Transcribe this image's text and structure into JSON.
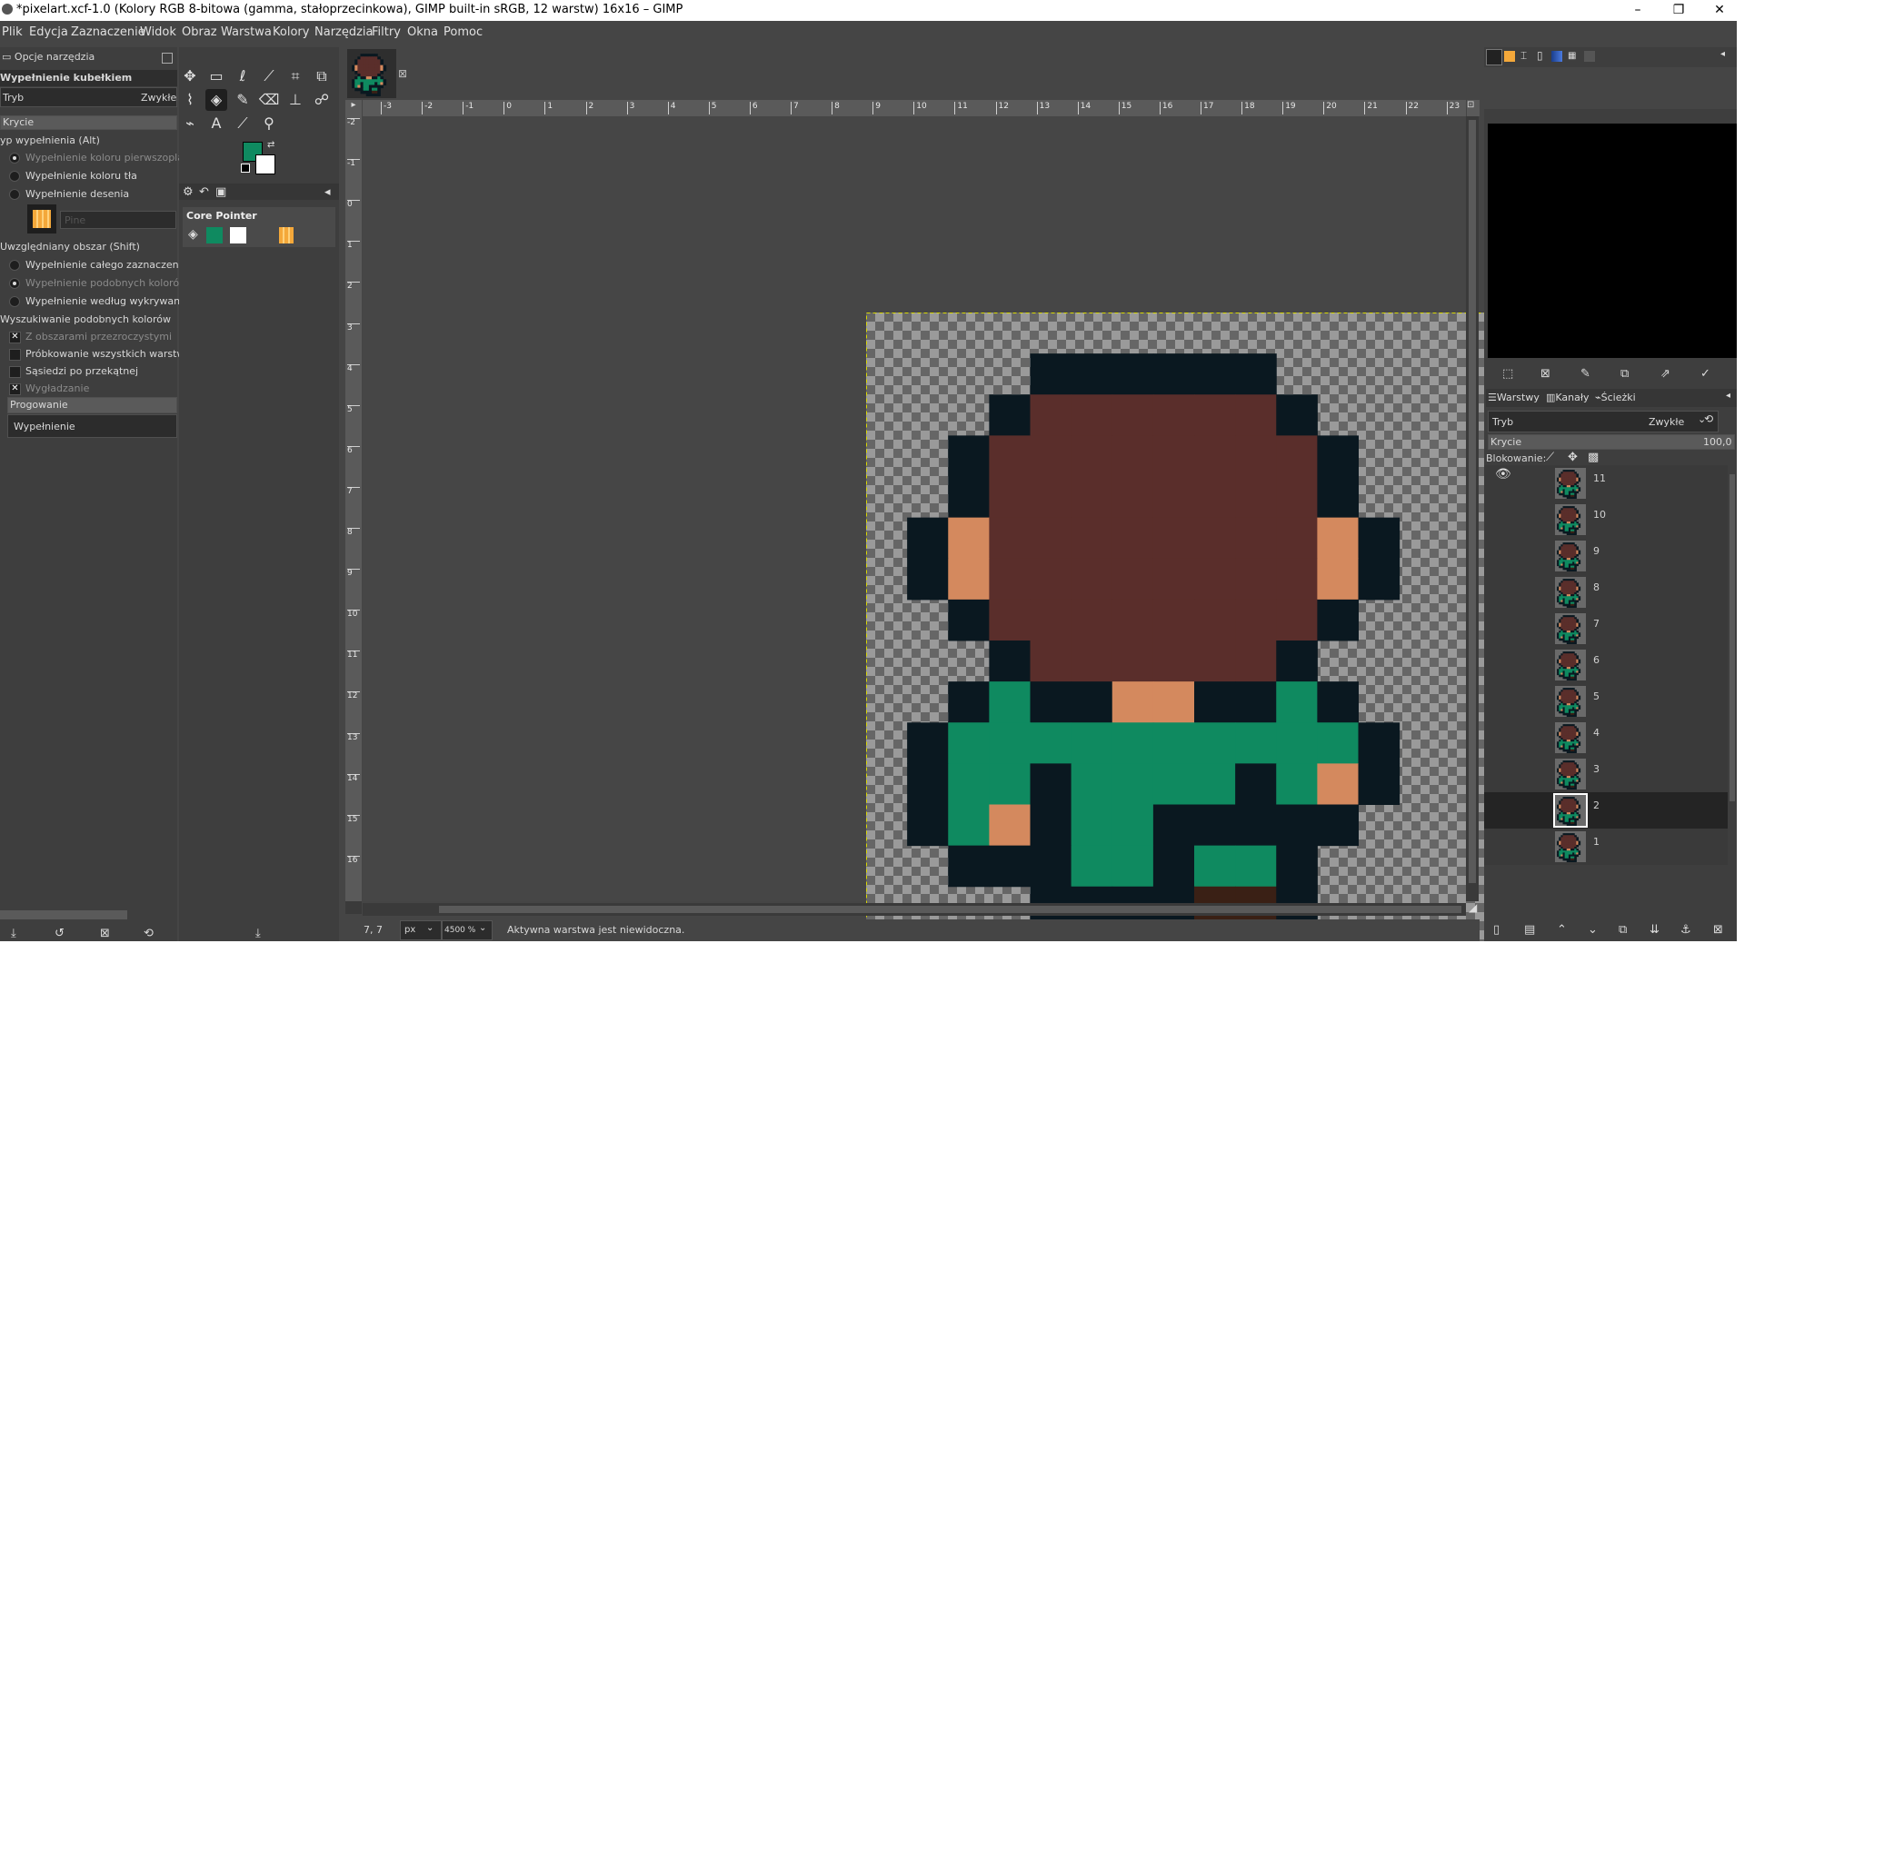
{
  "window": {
    "title": "*pixelart.xcf-1.0 (Kolory RGB 8-bitowa (gamma, stałoprzecinkowa), GIMP built-in sRGB, 12 warstw) 16x16 – GIMP",
    "minimize": "–",
    "restore": "❐",
    "close": "✕"
  },
  "menu": [
    "Plik",
    "Edycja",
    "Zaznaczenie",
    "Widok",
    "Obraz",
    "Warstwa",
    "Kolory",
    "Narzędzia",
    "Filtry",
    "Okna",
    "Pomoc"
  ],
  "tool_options": {
    "tab_title": "Opcje narzędzia",
    "tool_name": "Wypełnienie kubełkiem",
    "mode_label": "Tryb",
    "mode_value": "Zwykłe",
    "opacity_label": "Krycie",
    "fill_type_label": "yp wypełnienia  (Alt)",
    "fill_types": [
      {
        "label": "Wypełnienie koloru pierwszoplano",
        "selected": true
      },
      {
        "label": "Wypełnienie koloru tła",
        "selected": false
      },
      {
        "label": "Wypełnienie desenia",
        "selected": false
      }
    ],
    "pattern_name": "Pine",
    "area_label": "Uwzględniany obszar  (Shift)",
    "area_options": [
      {
        "label": "Wypełnienie całego zaznaczenia",
        "selected": false
      },
      {
        "label": "Wypełnienie podobnych kolorów",
        "selected": true
      },
      {
        "label": "Wypełnienie według wykrywania l",
        "selected": false
      }
    ],
    "similar_label": "Wyszukiwanie podobnych kolorów",
    "similar_options": [
      {
        "label": "Z obszarami przezroczystymi",
        "checked": true
      },
      {
        "label": "Próbkowanie wszystkich warstw",
        "checked": false
      },
      {
        "label": "Sąsiedzi po przekątnej",
        "checked": false
      },
      {
        "label": "Wygładzanie",
        "checked": true
      }
    ],
    "threshold_label": "Progowanie",
    "fill_by_label": "Wypełnienie"
  },
  "toolbox": {
    "device_status_title": "Core Pointer",
    "fg_color": "#0f8a60",
    "bg_color": "#ffffff"
  },
  "canvas": {
    "zoom": "4500 %",
    "unit": "px",
    "coords": "7, 7",
    "status_message": "Aktywna warstwa jest niewidoczna.",
    "ruler_h": [
      "-3",
      "-2",
      "-1",
      "0",
      "1",
      "2",
      "3",
      "4",
      "5",
      "6",
      "7",
      "8",
      "9",
      "10",
      "11",
      "12",
      "13",
      "14",
      "15",
      "16",
      "17",
      "18",
      "19",
      "20",
      "21",
      "22",
      "23"
    ],
    "ruler_v": [
      "-2",
      "-1",
      "0",
      "1",
      "2",
      "3",
      "4",
      "5",
      "6",
      "7",
      "8",
      "9",
      "10",
      "11",
      "12",
      "13",
      "14",
      "15",
      "16"
    ]
  },
  "layers_panel": {
    "tabs": [
      "Warstwy",
      "Kanały",
      "Ścieżki"
    ],
    "mode_label": "Tryb",
    "mode_value": "Zwykłe",
    "opacity_label": "Krycie",
    "opacity_value": "100,0",
    "lock_label": "Blokowanie:",
    "layers": [
      {
        "name": "11",
        "visible": true,
        "active": false
      },
      {
        "name": "10",
        "visible": false,
        "active": false
      },
      {
        "name": "9",
        "visible": false,
        "active": false
      },
      {
        "name": "8",
        "visible": false,
        "active": false
      },
      {
        "name": "7",
        "visible": false,
        "active": false
      },
      {
        "name": "6",
        "visible": false,
        "active": false
      },
      {
        "name": "5",
        "visible": false,
        "active": false
      },
      {
        "name": "4",
        "visible": false,
        "active": false
      },
      {
        "name": "3",
        "visible": false,
        "active": false
      },
      {
        "name": "2",
        "visible": false,
        "active": true
      },
      {
        "name": "1",
        "visible": false,
        "active": false
      }
    ]
  },
  "palette": {
    "outline": "#0a1820",
    "hair": "#5a2e2b",
    "skin": "#d4895e",
    "shirt": "#0f8a60",
    "belt": "#3a2015",
    "pattern": "#f4a83a"
  }
}
